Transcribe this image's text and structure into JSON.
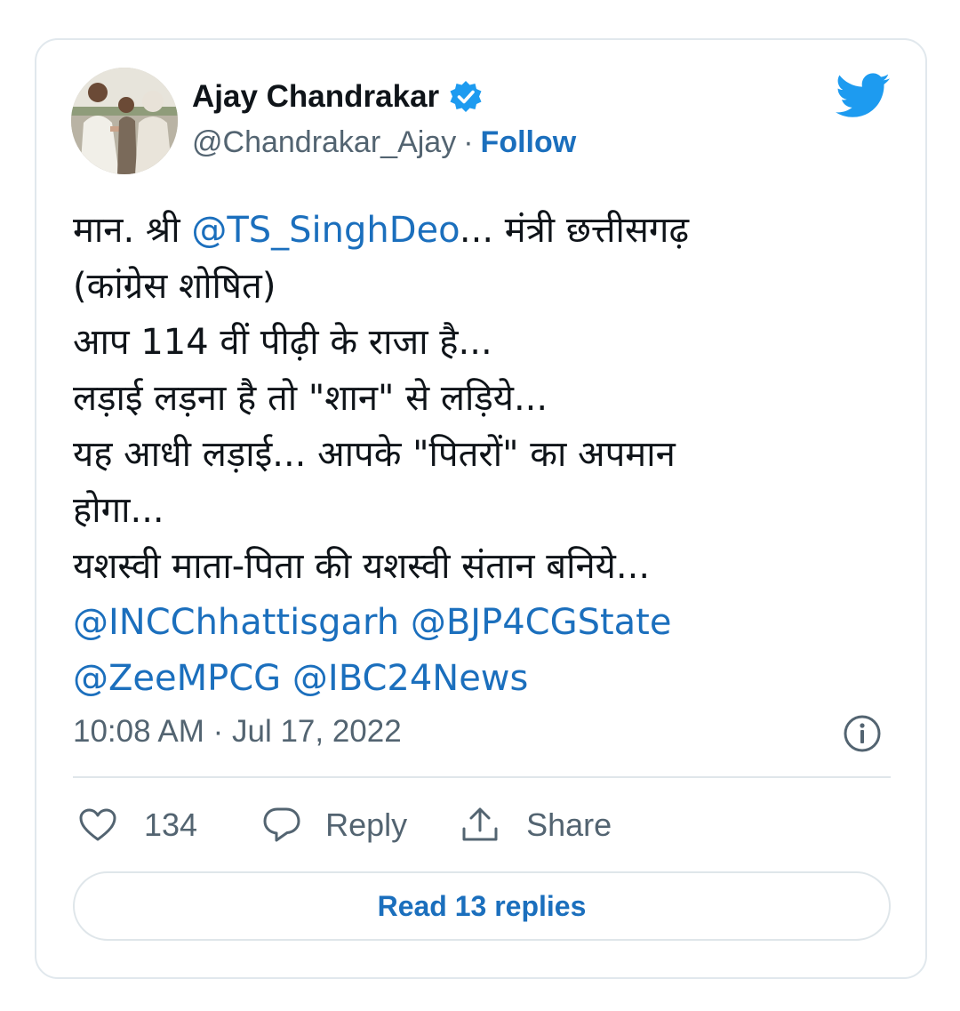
{
  "author": {
    "name": "Ajay Chandrakar",
    "handle": "@Chandrakar_Ajay",
    "separator": "·",
    "follow_label": "Follow"
  },
  "tweet": {
    "lines": [
      [
        {
          "text": "मान. श्री ",
          "type": "text"
        },
        {
          "text": "@TS_SinghDeo",
          "type": "mention"
        },
        {
          "text": "... मंत्री छत्तीसगढ़",
          "type": "text"
        }
      ],
      [
        {
          "text": "(कांग्रेस शोषित)",
          "type": "text"
        }
      ],
      [
        {
          "text": "आप 114 वीं पीढ़ी के राजा है...",
          "type": "text"
        }
      ],
      [
        {
          "text": "लड़ाई लड़ना है तो \"शान\" से लड़िये...",
          "type": "text"
        }
      ],
      [
        {
          "text": "यह आधी लड़ाई... आपके \"पितरों\" का अपमान",
          "type": "text"
        }
      ],
      [
        {
          "text": "होगा...",
          "type": "text"
        }
      ],
      [
        {
          "text": "यशस्वी माता-पिता की यशस्वी संतान बनिये...",
          "type": "text"
        }
      ],
      [
        {
          "text": "@INCChhattisgarh",
          "type": "mention"
        },
        {
          "text": " ",
          "type": "text"
        },
        {
          "text": "@BJP4CGState",
          "type": "mention"
        }
      ],
      [
        {
          "text": "@ZeeMPCG",
          "type": "mention"
        },
        {
          "text": " ",
          "type": "text"
        },
        {
          "text": "@IBC24News",
          "type": "mention"
        }
      ]
    ],
    "timestamp": "10:08 AM · Jul 17, 2022"
  },
  "actions": {
    "like_count": "134",
    "reply_label": "Reply",
    "share_label": "Share"
  },
  "read_replies_label": "Read 13 replies",
  "colors": {
    "link": "#1b6fbd",
    "twitter_blue": "#1d9bf0",
    "secondary_text": "#536471",
    "border": "#e1e8ed"
  },
  "icons": [
    "verified-badge-icon",
    "twitter-bird-icon",
    "info-icon",
    "heart-icon",
    "reply-bubble-icon",
    "share-icon"
  ]
}
